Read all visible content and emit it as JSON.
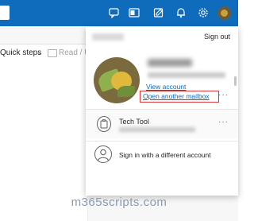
{
  "topbar": {
    "color": "#0f6cbd",
    "icons": [
      "chat-icon",
      "outlook-app-icon",
      "compose-icon",
      "bell-icon",
      "gear-icon",
      "avatar"
    ]
  },
  "ribbon": {
    "quick_steps": "Quick steps",
    "read_unread": "Read / Ur"
  },
  "account_panel": {
    "signout_label": "Sign out",
    "view_account_label": "View account",
    "open_mailbox_label": "Open another mailbox",
    "highlight_color": "#d83a3a",
    "accounts": [
      {
        "name": "Tech Tool"
      }
    ],
    "sign_in_different_label": "Sign in with a different account"
  },
  "watermark": "m365scripts.com"
}
